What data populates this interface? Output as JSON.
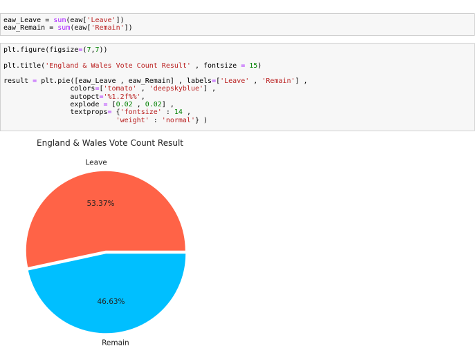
{
  "cell1": {
    "line1": {
      "a": "eaw_Leave = ",
      "fn": "sum",
      "b": "(eaw[",
      "str": "'Leave'",
      "c": "])"
    },
    "line2": {
      "a": "eaw_Remain = ",
      "fn": "sum",
      "b": "(eaw[",
      "str": "'Remain'",
      "c": "])"
    }
  },
  "cell2": {
    "l1": {
      "a": "plt.figure(figsize",
      "eq": "=",
      "b": "(",
      "n1": "7",
      "c": ",",
      "n2": "7",
      "d": "))"
    },
    "l2": {
      "a": "plt.title(",
      "s": "'England & Wales Vote Count Result'",
      "b": " , fontsize ",
      "eq": "=",
      "sp": " ",
      "n": "15",
      "c": ")"
    },
    "l3": {
      "a": "result ",
      "eq": "=",
      "b": " plt.pie([eaw_Leave , eaw_Remain] , labels",
      "eq2": "=",
      "c": "[",
      "s1": "'Leave'",
      "d": " , ",
      "s2": "'Remain'",
      "e": "] ,"
    },
    "l4": {
      "a": "                colors",
      "eq": "=",
      "b": "[",
      "s1": "'tomato'",
      "c": " , ",
      "s2": "'deepskyblue'",
      "d": "] ,"
    },
    "l5": {
      "a": "                autopct",
      "eq": "=",
      "s": "'%1.2f%%'",
      "b": ","
    },
    "l6": {
      "a": "                explode ",
      "eq": "=",
      "b": " [",
      "n1": "0.02",
      "c": " , ",
      "n2": "0.02",
      "d": "] ,"
    },
    "l7": {
      "a": "                textprops",
      "eq": "=",
      "b": " {",
      "s1": "'fontsize'",
      "c": " : ",
      "n": "14",
      "d": " ,"
    },
    "l8": {
      "a": "                           ",
      "s": "'weight'",
      "b": " : ",
      "s2": "'normal'",
      "c": "} )"
    }
  },
  "output": {
    "chart_data": {
      "type": "pie",
      "title": "England & Wales Vote Count Result",
      "labels": [
        "Leave",
        "Remain"
      ],
      "values": [
        53.37,
        46.63
      ],
      "pct_labels": [
        "53.37%",
        "46.63%"
      ],
      "colors": [
        "#ff6347",
        "#00bfff"
      ],
      "explode": [
        0.02,
        0.02
      ]
    }
  }
}
